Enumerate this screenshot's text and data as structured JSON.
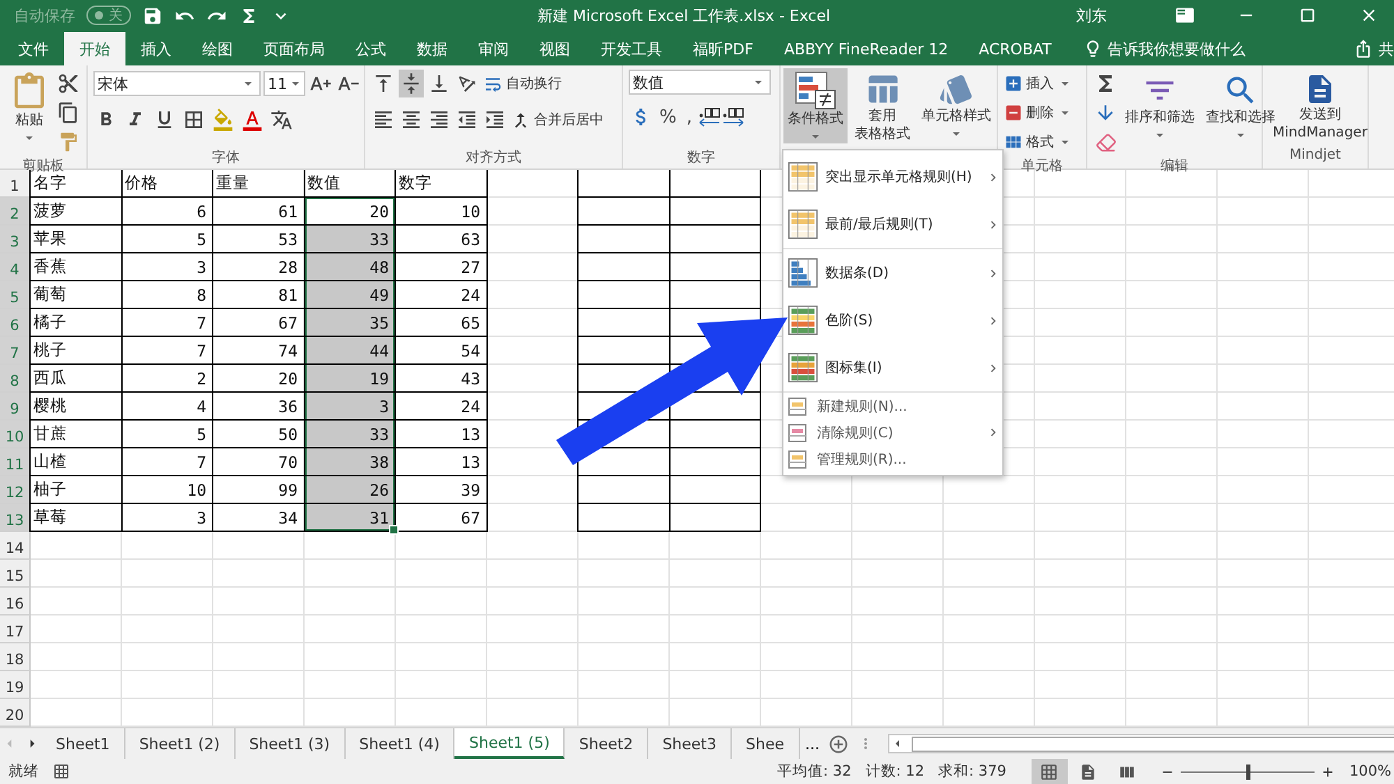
{
  "title_bar": {
    "autosave_label": "自动保存",
    "autosave_toggle": "关",
    "autosave_on": false,
    "title": "新建 Microsoft Excel 工作表.xlsx  -  Excel",
    "user": "刘东"
  },
  "ribbon_tabs": [
    {
      "label": "文件",
      "selected": false
    },
    {
      "label": "开始",
      "selected": true
    },
    {
      "label": "插入",
      "selected": false
    },
    {
      "label": "绘图",
      "selected": false
    },
    {
      "label": "页面布局",
      "selected": false
    },
    {
      "label": "公式",
      "selected": false
    },
    {
      "label": "数据",
      "selected": false
    },
    {
      "label": "审阅",
      "selected": false
    },
    {
      "label": "视图",
      "selected": false
    },
    {
      "label": "开发工具",
      "selected": false
    },
    {
      "label": "福昕PDF",
      "selected": false
    },
    {
      "label": "ABBYY FineReader 12",
      "selected": false
    },
    {
      "label": "ACROBAT",
      "selected": false
    }
  ],
  "tell_me": "告诉我你想要做什么",
  "share": "共",
  "ribbon": {
    "clipboard": {
      "paste": "粘贴",
      "label": "剪贴板"
    },
    "font": {
      "font_name": "宋体",
      "font_size": "11",
      "label": "字体"
    },
    "alignment": {
      "vertical": [
        {
          "selected": false
        },
        {
          "selected": true
        },
        {
          "selected": false
        }
      ],
      "wrap": "自动换行",
      "merge": "合并后居中",
      "label": "对齐方式"
    },
    "number": {
      "format": "数值",
      "percent": "%",
      "comma": ",",
      "label": "数字"
    },
    "styles": {
      "conditional": "条件格式",
      "conditional_open": true,
      "table_format": [
        "套用",
        "表格格式"
      ],
      "cell_styles": "单元格样式"
    },
    "cells": {
      "insert": "插入",
      "delete": "删除",
      "format": "格式",
      "label": "单元格"
    },
    "editing": {
      "sort": "排序和筛选",
      "find": "查找和选择",
      "label": "编辑"
    },
    "mindjet": {
      "send": [
        "发送到",
        "MindManager"
      ],
      "label": "Mindjet"
    }
  },
  "sheet": {
    "row_numbers": [
      "1",
      "2",
      "3",
      "4",
      "5",
      "6",
      "7",
      "8",
      "9",
      "10",
      "11",
      "12",
      "13",
      "14",
      "15",
      "16",
      "17",
      "18",
      "19",
      "20"
    ],
    "header": [
      "名字",
      "价格",
      "重量",
      "数值",
      "数字"
    ],
    "rows": [
      {
        "cells": [
          "菠萝",
          "6",
          "61",
          "20",
          "10"
        ],
        "value_shaded": false,
        "value_selected": true
      },
      {
        "cells": [
          "苹果",
          "5",
          "53",
          "33",
          "63"
        ],
        "value_shaded": true,
        "value_selected": true
      },
      {
        "cells": [
          "香蕉",
          "3",
          "28",
          "48",
          "27"
        ],
        "value_shaded": true,
        "value_selected": true
      },
      {
        "cells": [
          "葡萄",
          "8",
          "81",
          "49",
          "24"
        ],
        "value_shaded": true,
        "value_selected": true
      },
      {
        "cells": [
          "橘子",
          "7",
          "67",
          "35",
          "65"
        ],
        "value_shaded": true,
        "value_selected": true
      },
      {
        "cells": [
          "桃子",
          "7",
          "74",
          "44",
          "54"
        ],
        "value_shaded": true,
        "value_selected": true
      },
      {
        "cells": [
          "西瓜",
          "2",
          "20",
          "19",
          "43"
        ],
        "value_shaded": true,
        "value_selected": true
      },
      {
        "cells": [
          "樱桃",
          "4",
          "36",
          "3",
          "24"
        ],
        "value_shaded": true,
        "value_selected": true
      },
      {
        "cells": [
          "甘蔗",
          "5",
          "50",
          "33",
          "13"
        ],
        "value_shaded": true,
        "value_selected": true
      },
      {
        "cells": [
          "山楂",
          "7",
          "70",
          "38",
          "13"
        ],
        "value_shaded": true,
        "value_selected": true
      },
      {
        "cells": [
          "柚子",
          "10",
          "99",
          "26",
          "39"
        ],
        "value_shaded": true,
        "value_selected": true
      },
      {
        "cells": [
          "草莓",
          "3",
          "34",
          "31",
          "67"
        ],
        "value_shaded": true,
        "value_selected": true
      }
    ]
  },
  "menu": {
    "sections": [
      [
        {
          "kind": "large",
          "label": "突出显示单元格规则(H)",
          "submenu": true
        },
        {
          "kind": "large",
          "label": "最前/最后规则(T)",
          "submenu": true
        }
      ],
      [
        {
          "kind": "large",
          "label": "数据条(D)",
          "submenu": true
        },
        {
          "kind": "large",
          "label": "色阶(S)",
          "submenu": true
        },
        {
          "kind": "large",
          "label": "图标集(I)",
          "submenu": true
        }
      ],
      [
        {
          "kind": "small",
          "label": "新建规则(N)...",
          "submenu": false
        },
        {
          "kind": "small",
          "label": "清除规则(C)",
          "submenu": true
        },
        {
          "kind": "small",
          "label": "管理规则(R)...",
          "submenu": false
        }
      ]
    ]
  },
  "sheet_tabs": [
    {
      "label": "Sheet1",
      "selected": false
    },
    {
      "label": "Sheet1 (2)",
      "selected": false
    },
    {
      "label": "Sheet1 (3)",
      "selected": false
    },
    {
      "label": "Sheet1 (4)",
      "selected": false
    },
    {
      "label": "Sheet1 (5)",
      "selected": true
    },
    {
      "label": "Sheet2",
      "selected": false
    },
    {
      "label": "Sheet3",
      "selected": false
    },
    {
      "label": "Shee",
      "selected": false
    }
  ],
  "tabs_overflow": "...",
  "status_bar": {
    "ready": "就绪",
    "stats": [
      "平均值: 32",
      "计数: 12",
      "求和: 379"
    ],
    "views": [
      {
        "selected": true
      },
      {
        "selected": false
      },
      {
        "selected": false
      }
    ],
    "zoom": {
      "level": 0.5,
      "label": "100%"
    }
  }
}
